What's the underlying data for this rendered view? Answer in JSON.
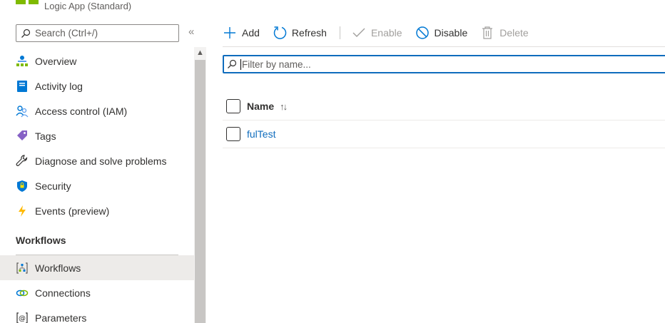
{
  "header": {
    "subtitle": "Logic App (Standard)"
  },
  "search": {
    "placeholder": "Search (Ctrl+/)"
  },
  "collapse_label": "«",
  "sidebar": {
    "items": [
      {
        "label": "Overview",
        "icon": "overview-icon"
      },
      {
        "label": "Activity log",
        "icon": "activity-log-icon"
      },
      {
        "label": "Access control (IAM)",
        "icon": "access-control-icon"
      },
      {
        "label": "Tags",
        "icon": "tag-icon"
      },
      {
        "label": "Diagnose and solve problems",
        "icon": "wrench-icon"
      },
      {
        "label": "Security",
        "icon": "shield-icon"
      },
      {
        "label": "Events (preview)",
        "icon": "lightning-icon"
      }
    ],
    "section": "Workflows",
    "section_items": [
      {
        "label": "Workflows",
        "icon": "workflow-icon",
        "selected": true
      },
      {
        "label": "Connections",
        "icon": "connections-icon"
      },
      {
        "label": "Parameters",
        "icon": "parameters-icon"
      }
    ]
  },
  "toolbar": {
    "add": "Add",
    "refresh": "Refresh",
    "enable": "Enable",
    "disable": "Disable",
    "delete": "Delete"
  },
  "filter": {
    "placeholder": "Filter by name..."
  },
  "table": {
    "header": "Name",
    "sort_glyph": "↑↓",
    "rows": [
      {
        "name": "fulTest"
      }
    ]
  },
  "colors": {
    "accent": "#0f6cbd",
    "selected_bg": "#edebe9",
    "logo_green": "#7fba00"
  }
}
